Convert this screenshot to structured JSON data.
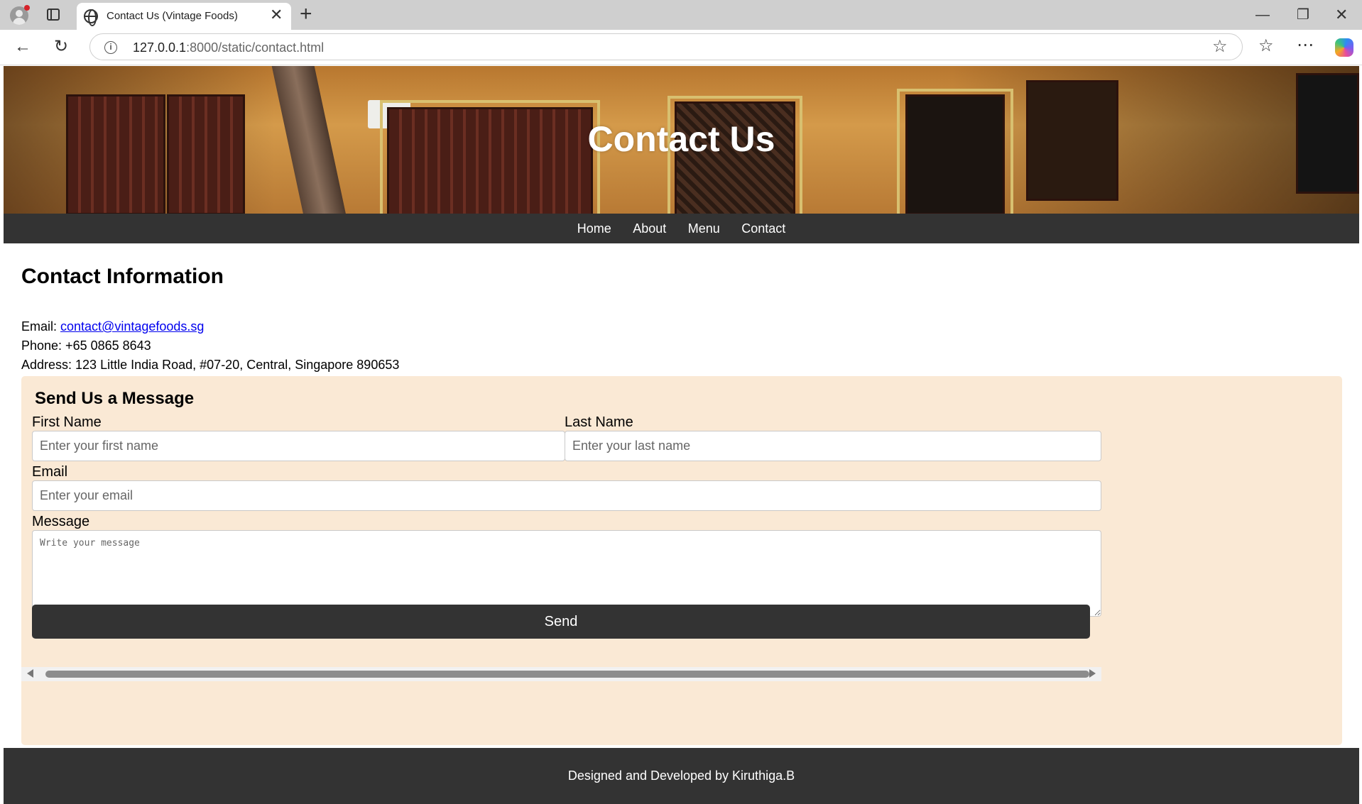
{
  "browser": {
    "tab_title": "Contact Us (Vintage Foods)",
    "tab_close": "✕",
    "new_tab": "+",
    "url_host": "127.0.0.1",
    "url_rest": ":8000/static/contact.html",
    "icons": [
      "profile-icon",
      "tab-actions-icon",
      "globe-icon",
      "back-icon",
      "reload-icon",
      "info-icon",
      "star-icon",
      "favorites-icon",
      "more-icon",
      "copilot-icon"
    ]
  },
  "hero": {
    "title": "Contact Us"
  },
  "nav": {
    "items": [
      "Home",
      "About",
      "Menu",
      "Contact"
    ]
  },
  "contact_info": {
    "heading": "Contact Information",
    "email_label": "Email: ",
    "email": "contact@vintagefoods.sg",
    "phone": "Phone: +65 0865 8643",
    "address": "Address: 123 Little India Road, #07-20, Central, Singapore 890653"
  },
  "form": {
    "title": "Send Us a Message",
    "first_name_label": "First Name",
    "first_name_placeholder": "Enter your first name",
    "first_name_value": "",
    "last_name_label": "Last Name",
    "last_name_placeholder": "Enter your last name",
    "last_name_value": "",
    "email_label": "Email",
    "email_placeholder": "Enter your email",
    "email_value": "",
    "message_label": "Message",
    "message_placeholder": "Write your message",
    "send_label": "Send",
    "background_color": "#fae9d5"
  },
  "footer": {
    "text": "Designed and Developed by Kiruthiga.B"
  },
  "colors": {
    "nav_bg": "#333333",
    "link": "#0000ee"
  }
}
